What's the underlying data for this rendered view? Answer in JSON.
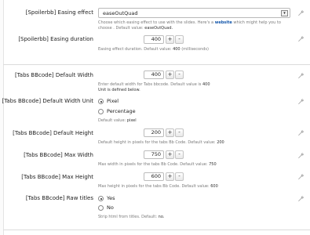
{
  "options": {
    "easing_effect": {
      "label": "[Spoilerbb] Easing effect",
      "value": "easeOutQuad",
      "hint_pre": "Choose which easing effect to use with the slides. Here's a",
      "hint_link": "website",
      "hint_post": "which might help you to",
      "hint_line2_pre": "choose . Default value:",
      "hint_default": "easeOutQuad."
    },
    "easing_duration": {
      "label": "[Spoilerbb] Easing duration",
      "value": "400",
      "hint_pre": "Easing effect duration. Default value:",
      "hint_default": "400",
      "hint_post": "(milliseconds)"
    },
    "tabs_default_width": {
      "label": "[Tabs BBcode] Default Width",
      "value": "400",
      "hint_pre": "Enter default width for Tabs bbcode. Default value is",
      "hint_default": "400",
      "hint_line2": "Unit is defined below."
    },
    "tabs_default_width_unit": {
      "label": "[Tabs BBcode] Default Width Unit",
      "options": [
        "Pixel",
        "Percentage"
      ],
      "selected": "Pixel",
      "hint_pre": "Default value:",
      "hint_default": "pixel"
    },
    "tabs_default_height": {
      "label": "[Tabs BBcode] Default Height",
      "value": "200",
      "hint_pre": "Default height in pixels for the tabs Bb Code. Default value:",
      "hint_default": "200"
    },
    "tabs_max_width": {
      "label": "[Tabs BBcode] Max Width",
      "value": "750",
      "hint_pre": "Max width in pixels for the tabs Bb Code. Default value:",
      "hint_default": "750"
    },
    "tabs_max_height": {
      "label": "[Tabs BBcode] Max Height",
      "value": "600",
      "hint_pre": "Max height in pixels for the tabs Bb Code. Default value:",
      "hint_default": "600"
    },
    "tabs_raw_titles": {
      "label": "[Tabs BBcode] Raw titles",
      "options": [
        "Yes",
        "No"
      ],
      "selected": "Yes",
      "hint_pre": "Strip html from titles. Default:",
      "hint_default": "no."
    }
  },
  "controls": {
    "plus": "+",
    "minus": "-",
    "dropdown_arrow": "▾"
  },
  "icons": {
    "edit": "wrench-icon",
    "color": "#a9a9a9"
  }
}
